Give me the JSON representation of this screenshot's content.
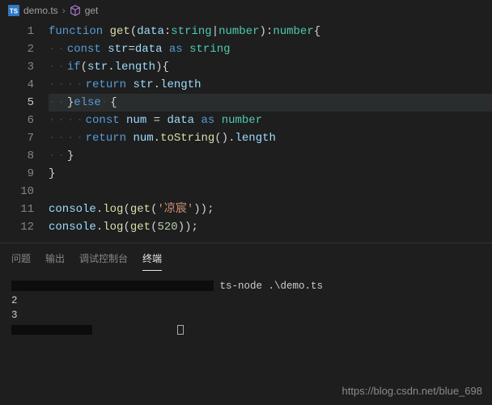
{
  "breadcrumb": {
    "file_icon": "TS",
    "file": "demo.ts",
    "symbol_icon": "cube",
    "symbol": "get"
  },
  "editor": {
    "current_line": 5,
    "lines": [
      {
        "n": 1,
        "segs": [
          [
            "kw",
            "function"
          ],
          [
            "punc",
            " "
          ],
          [
            "fn",
            "get"
          ],
          [
            "punc",
            "("
          ],
          [
            "var",
            "data"
          ],
          [
            "punc",
            ":"
          ],
          [
            "type",
            "string"
          ],
          [
            "punc",
            "|"
          ],
          [
            "type",
            "number"
          ],
          [
            "punc",
            "):"
          ],
          [
            "type",
            "number"
          ],
          [
            "punc",
            "{"
          ]
        ]
      },
      {
        "n": 2,
        "segs": [
          [
            "ws",
            "··"
          ],
          [
            "kw",
            "const"
          ],
          [
            "punc",
            " "
          ],
          [
            "var",
            "str"
          ],
          [
            "punc",
            "="
          ],
          [
            "var",
            "data"
          ],
          [
            "punc",
            " "
          ],
          [
            "kw",
            "as"
          ],
          [
            "punc",
            " "
          ],
          [
            "type",
            "string"
          ]
        ]
      },
      {
        "n": 3,
        "segs": [
          [
            "ws",
            "··"
          ],
          [
            "kw",
            "if"
          ],
          [
            "punc",
            "("
          ],
          [
            "var",
            "str"
          ],
          [
            "punc",
            "."
          ],
          [
            "var",
            "length"
          ],
          [
            "punc",
            "){"
          ]
        ]
      },
      {
        "n": 4,
        "segs": [
          [
            "ws",
            "····"
          ],
          [
            "kw",
            "return"
          ],
          [
            "punc",
            " "
          ],
          [
            "var",
            "str"
          ],
          [
            "punc",
            "."
          ],
          [
            "var",
            "length"
          ]
        ]
      },
      {
        "n": 5,
        "segs": [
          [
            "ws",
            "··"
          ],
          [
            "punc",
            "}"
          ],
          [
            "kw",
            "else"
          ],
          [
            "ws",
            "·"
          ],
          [
            "punc",
            "{"
          ]
        ]
      },
      {
        "n": 6,
        "segs": [
          [
            "ws",
            "····"
          ],
          [
            "kw",
            "const"
          ],
          [
            "punc",
            " "
          ],
          [
            "var",
            "num"
          ],
          [
            "punc",
            " = "
          ],
          [
            "var",
            "data"
          ],
          [
            "punc",
            " "
          ],
          [
            "kw",
            "as"
          ],
          [
            "punc",
            " "
          ],
          [
            "type",
            "number"
          ]
        ]
      },
      {
        "n": 7,
        "segs": [
          [
            "ws",
            "····"
          ],
          [
            "kw",
            "return"
          ],
          [
            "punc",
            " "
          ],
          [
            "var",
            "num"
          ],
          [
            "punc",
            "."
          ],
          [
            "fn",
            "toString"
          ],
          [
            "punc",
            "()."
          ],
          [
            "var",
            "length"
          ]
        ]
      },
      {
        "n": 8,
        "segs": [
          [
            "ws",
            "··"
          ],
          [
            "punc",
            "}"
          ]
        ]
      },
      {
        "n": 9,
        "segs": [
          [
            "punc",
            "}"
          ]
        ]
      },
      {
        "n": 10,
        "segs": []
      },
      {
        "n": 11,
        "segs": [
          [
            "var",
            "console"
          ],
          [
            "punc",
            "."
          ],
          [
            "fn",
            "log"
          ],
          [
            "punc",
            "("
          ],
          [
            "fn",
            "get"
          ],
          [
            "punc",
            "("
          ],
          [
            "str",
            "'凉宸'"
          ],
          [
            "punc",
            "));"
          ]
        ]
      },
      {
        "n": 12,
        "segs": [
          [
            "var",
            "console"
          ],
          [
            "punc",
            "."
          ],
          [
            "fn",
            "log"
          ],
          [
            "punc",
            "("
          ],
          [
            "fn",
            "get"
          ],
          [
            "punc",
            "("
          ],
          [
            "num",
            "520"
          ],
          [
            "punc",
            "));"
          ]
        ]
      }
    ]
  },
  "panel": {
    "tabs": {
      "problems": "问题",
      "output": "输出",
      "debug": "调试控制台",
      "terminal": "终端"
    },
    "active_tab": "terminal",
    "terminal": {
      "command": "ts-node .\\demo.ts",
      "out1": "2",
      "out2": "3"
    }
  },
  "watermark": "https://blog.csdn.net/blue_698"
}
